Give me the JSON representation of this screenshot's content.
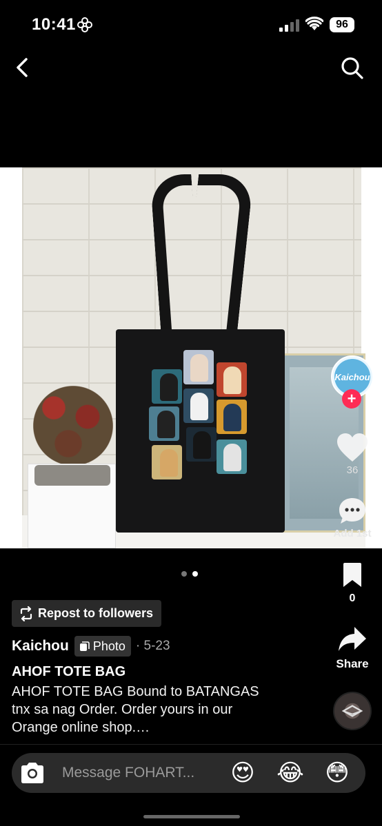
{
  "status_bar": {
    "time": "10:41",
    "battery": "96",
    "icons": [
      "flower-icon",
      "signal-icon",
      "wifi-icon"
    ]
  },
  "nav": {
    "back_icon": "chevron-left-icon",
    "search_icon": "search-icon"
  },
  "post": {
    "image": "Black tote bag with chibi character print against white brick wall",
    "page_count": 2,
    "active_page": 2,
    "repost_label": "Repost to followers",
    "username": "Kaichou",
    "type_tag": "Photo",
    "date": "· 5-23",
    "title": "AHOF TOTE BAG",
    "description": "AHOF TOTE BAG Bound to BATANGAS tnx sa nag Order. Order yours in our Orange online shop.…"
  },
  "actions": {
    "avatar_text": "Kaichou",
    "follow_icon": "+",
    "likes": "36",
    "comment_label": "Add 1st",
    "bookmarks": "0",
    "share_label": "Share"
  },
  "message_bar": {
    "placeholder": "Message FOHART...",
    "emojis": [
      "😍",
      "😂",
      "😳"
    ]
  },
  "colors": {
    "background": "#000000",
    "accent": "#fe2c55",
    "pill": "#2b2b2b"
  }
}
